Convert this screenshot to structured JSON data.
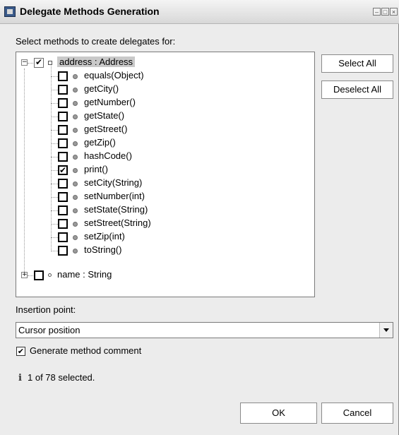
{
  "window": {
    "title": "Delegate Methods Generation",
    "app_icon": "eclipse-dialog-icon"
  },
  "prompt": "Select methods to create delegates for:",
  "tree": {
    "root": {
      "label": "address : Address",
      "checked": true,
      "expanded": true,
      "toggle": "−"
    },
    "children": [
      {
        "label": "equals(Object)",
        "checked": false
      },
      {
        "label": "getCity()",
        "checked": false
      },
      {
        "label": "getNumber()",
        "checked": false
      },
      {
        "label": "getState()",
        "checked": false
      },
      {
        "label": "getStreet()",
        "checked": false
      },
      {
        "label": "getZip()",
        "checked": false
      },
      {
        "label": "hashCode()",
        "checked": false
      },
      {
        "label": "print()",
        "checked": true
      },
      {
        "label": "setCity(String)",
        "checked": false
      },
      {
        "label": "setNumber(int)",
        "checked": false
      },
      {
        "label": "setState(String)",
        "checked": false
      },
      {
        "label": "setStreet(String)",
        "checked": false
      },
      {
        "label": "setZip(int)",
        "checked": false
      },
      {
        "label": "toString()",
        "checked": false
      }
    ],
    "second_root": {
      "label": "name : String",
      "checked": false,
      "expanded": false,
      "toggle": "+"
    }
  },
  "buttons": {
    "select_all": "Select All",
    "deselect_all": "Deselect All",
    "ok": "OK",
    "cancel": "Cancel"
  },
  "insertion": {
    "label": "Insertion point:",
    "value": "Cursor position"
  },
  "generate_comment": {
    "label": "Generate method comment",
    "checked": true
  },
  "status": {
    "icon": "info-icon",
    "text": "1 of 78 selected."
  }
}
